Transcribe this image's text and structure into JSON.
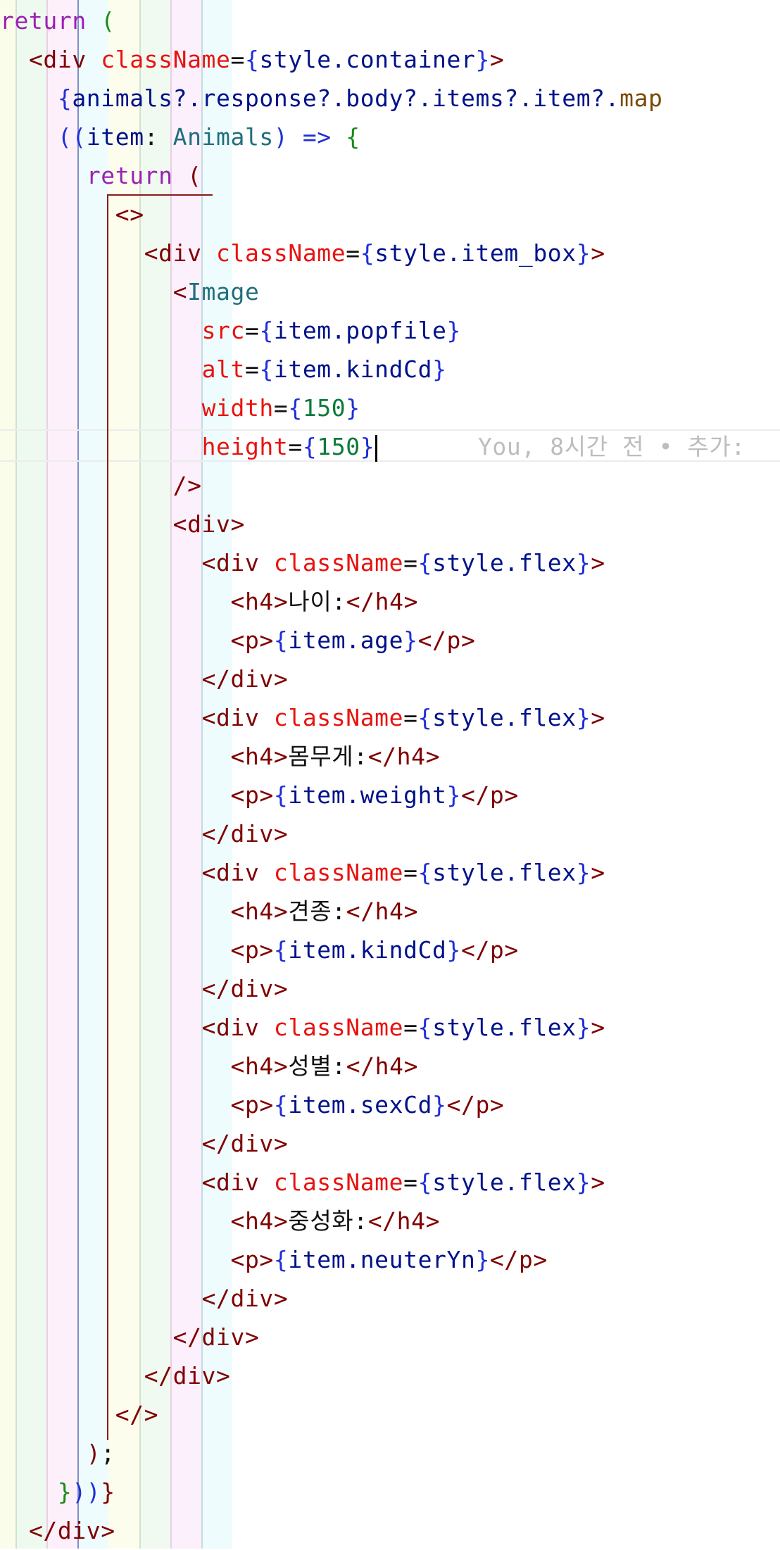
{
  "editor": {
    "colors": {
      "keyword": "#9b21b2",
      "paren": "#1a8a1a",
      "brace": "#1f2fd8",
      "tag": "#800000",
      "attribute": "#e8130f",
      "variable": "#00128a",
      "function": "#7b4a00",
      "type": "#1f6f7a",
      "number": "#0b7a3b",
      "text": "#111111",
      "blame": "#bdbdbd"
    },
    "lines": [
      [
        [
          "kw",
          "return"
        ],
        [
          "tx",
          " "
        ],
        [
          "pn",
          "("
        ]
      ],
      [
        [
          "tx",
          "  "
        ],
        [
          "tg",
          "<div"
        ],
        [
          "tx",
          " "
        ],
        [
          "at",
          "className"
        ],
        [
          "tx",
          "="
        ],
        [
          "pb",
          "{"
        ],
        [
          "vr",
          "style.container"
        ],
        [
          "pb",
          "}"
        ],
        [
          "tg",
          ">"
        ]
      ],
      [
        [
          "tx",
          "    "
        ],
        [
          "pb",
          "{"
        ],
        [
          "vr",
          "animals?.response?.body?.items?.item?."
        ],
        [
          "fn",
          "map"
        ]
      ],
      [
        [
          "tx",
          "    "
        ],
        [
          "pb",
          "(("
        ],
        [
          "vr",
          "item"
        ],
        [
          "tx",
          ": "
        ],
        [
          "ty",
          "Animals"
        ],
        [
          "pb",
          ")"
        ],
        [
          "tx",
          " "
        ],
        [
          "pb",
          "=>"
        ],
        [
          "tx",
          " "
        ],
        [
          "pn",
          "{"
        ]
      ],
      [
        [
          "tx",
          "      "
        ],
        [
          "kw",
          "return"
        ],
        [
          "tx",
          " "
        ],
        [
          "tg",
          "("
        ]
      ],
      [
        [
          "tx",
          "        "
        ],
        [
          "tg",
          "<>"
        ]
      ],
      [
        [
          "tx",
          "          "
        ],
        [
          "tg",
          "<div"
        ],
        [
          "tx",
          " "
        ],
        [
          "at",
          "className"
        ],
        [
          "tx",
          "="
        ],
        [
          "pb",
          "{"
        ],
        [
          "vr",
          "style.item_box"
        ],
        [
          "pb",
          "}"
        ],
        [
          "tg",
          ">"
        ]
      ],
      [
        [
          "tx",
          "            "
        ],
        [
          "tg",
          "<"
        ],
        [
          "ty",
          "Image"
        ]
      ],
      [
        [
          "tx",
          "              "
        ],
        [
          "at",
          "src"
        ],
        [
          "tx",
          "="
        ],
        [
          "pb",
          "{"
        ],
        [
          "vr",
          "item.popfile"
        ],
        [
          "pb",
          "}"
        ]
      ],
      [
        [
          "tx",
          "              "
        ],
        [
          "at",
          "alt"
        ],
        [
          "tx",
          "="
        ],
        [
          "pb",
          "{"
        ],
        [
          "vr",
          "item.kindCd"
        ],
        [
          "pb",
          "}"
        ]
      ],
      [
        [
          "tx",
          "              "
        ],
        [
          "at",
          "width"
        ],
        [
          "tx",
          "="
        ],
        [
          "pb",
          "{"
        ],
        [
          "nm",
          "150"
        ],
        [
          "pb",
          "}"
        ]
      ],
      [
        [
          "tx",
          "              "
        ],
        [
          "at",
          "height"
        ],
        [
          "tx",
          "="
        ],
        [
          "pb",
          "{"
        ],
        [
          "nm",
          "150"
        ],
        [
          "pb",
          "}"
        ],
        [
          "caret",
          ""
        ],
        [
          "tx",
          "       "
        ],
        [
          "bl",
          "You, 8시간 전 • 추가:"
        ]
      ],
      [
        [
          "tx",
          "            "
        ],
        [
          "tg",
          "/>"
        ]
      ],
      [
        [
          "tx",
          "            "
        ],
        [
          "tg",
          "<div>"
        ]
      ],
      [
        [
          "tx",
          "              "
        ],
        [
          "tg",
          "<div"
        ],
        [
          "tx",
          " "
        ],
        [
          "at",
          "className"
        ],
        [
          "tx",
          "="
        ],
        [
          "pb",
          "{"
        ],
        [
          "vr",
          "style.flex"
        ],
        [
          "pb",
          "}"
        ],
        [
          "tg",
          ">"
        ]
      ],
      [
        [
          "tx",
          "                "
        ],
        [
          "tg",
          "<h4>"
        ],
        [
          "tx",
          "나이:"
        ],
        [
          "tg",
          "</h4>"
        ]
      ],
      [
        [
          "tx",
          "                "
        ],
        [
          "tg",
          "<p>"
        ],
        [
          "pb",
          "{"
        ],
        [
          "vr",
          "item.age"
        ],
        [
          "pb",
          "}"
        ],
        [
          "tg",
          "</p>"
        ]
      ],
      [
        [
          "tx",
          "              "
        ],
        [
          "tg",
          "</div>"
        ]
      ],
      [
        [
          "tx",
          "              "
        ],
        [
          "tg",
          "<div"
        ],
        [
          "tx",
          " "
        ],
        [
          "at",
          "className"
        ],
        [
          "tx",
          "="
        ],
        [
          "pb",
          "{"
        ],
        [
          "vr",
          "style.flex"
        ],
        [
          "pb",
          "}"
        ],
        [
          "tg",
          ">"
        ]
      ],
      [
        [
          "tx",
          "                "
        ],
        [
          "tg",
          "<h4>"
        ],
        [
          "tx",
          "몸무게:"
        ],
        [
          "tg",
          "</h4>"
        ]
      ],
      [
        [
          "tx",
          "                "
        ],
        [
          "tg",
          "<p>"
        ],
        [
          "pb",
          "{"
        ],
        [
          "vr",
          "item.weight"
        ],
        [
          "pb",
          "}"
        ],
        [
          "tg",
          "</p>"
        ]
      ],
      [
        [
          "tx",
          "              "
        ],
        [
          "tg",
          "</div>"
        ]
      ],
      [
        [
          "tx",
          "              "
        ],
        [
          "tg",
          "<div"
        ],
        [
          "tx",
          " "
        ],
        [
          "at",
          "className"
        ],
        [
          "tx",
          "="
        ],
        [
          "pb",
          "{"
        ],
        [
          "vr",
          "style.flex"
        ],
        [
          "pb",
          "}"
        ],
        [
          "tg",
          ">"
        ]
      ],
      [
        [
          "tx",
          "                "
        ],
        [
          "tg",
          "<h4>"
        ],
        [
          "tx",
          "견종:"
        ],
        [
          "tg",
          "</h4>"
        ]
      ],
      [
        [
          "tx",
          "                "
        ],
        [
          "tg",
          "<p>"
        ],
        [
          "pb",
          "{"
        ],
        [
          "vr",
          "item.kindCd"
        ],
        [
          "pb",
          "}"
        ],
        [
          "tg",
          "</p>"
        ]
      ],
      [
        [
          "tx",
          "              "
        ],
        [
          "tg",
          "</div>"
        ]
      ],
      [
        [
          "tx",
          "              "
        ],
        [
          "tg",
          "<div"
        ],
        [
          "tx",
          " "
        ],
        [
          "at",
          "className"
        ],
        [
          "tx",
          "="
        ],
        [
          "pb",
          "{"
        ],
        [
          "vr",
          "style.flex"
        ],
        [
          "pb",
          "}"
        ],
        [
          "tg",
          ">"
        ]
      ],
      [
        [
          "tx",
          "                "
        ],
        [
          "tg",
          "<h4>"
        ],
        [
          "tx",
          "성별:"
        ],
        [
          "tg",
          "</h4>"
        ]
      ],
      [
        [
          "tx",
          "                "
        ],
        [
          "tg",
          "<p>"
        ],
        [
          "pb",
          "{"
        ],
        [
          "vr",
          "item.sexCd"
        ],
        [
          "pb",
          "}"
        ],
        [
          "tg",
          "</p>"
        ]
      ],
      [
        [
          "tx",
          "              "
        ],
        [
          "tg",
          "</div>"
        ]
      ],
      [
        [
          "tx",
          "              "
        ],
        [
          "tg",
          "<div"
        ],
        [
          "tx",
          " "
        ],
        [
          "at",
          "className"
        ],
        [
          "tx",
          "="
        ],
        [
          "pb",
          "{"
        ],
        [
          "vr",
          "style.flex"
        ],
        [
          "pb",
          "}"
        ],
        [
          "tg",
          ">"
        ]
      ],
      [
        [
          "tx",
          "                "
        ],
        [
          "tg",
          "<h4>"
        ],
        [
          "tx",
          "중성화:"
        ],
        [
          "tg",
          "</h4>"
        ]
      ],
      [
        [
          "tx",
          "                "
        ],
        [
          "tg",
          "<p>"
        ],
        [
          "pb",
          "{"
        ],
        [
          "vr",
          "item.neuterYn"
        ],
        [
          "pb",
          "}"
        ],
        [
          "tg",
          "</p>"
        ]
      ],
      [
        [
          "tx",
          "              "
        ],
        [
          "tg",
          "</div>"
        ]
      ],
      [
        [
          "tx",
          "            "
        ],
        [
          "tg",
          "</div>"
        ]
      ],
      [
        [
          "tx",
          "          "
        ],
        [
          "tg",
          "</div>"
        ]
      ],
      [
        [
          "tx",
          "        "
        ],
        [
          "tg",
          "</>"
        ]
      ],
      [
        [
          "tx",
          "      "
        ],
        [
          "tg",
          ")"
        ],
        [
          "tx",
          ";"
        ]
      ],
      [
        [
          "tx",
          "    "
        ],
        [
          "pn",
          "}"
        ],
        [
          "pb",
          "))"
        ],
        [
          "tg",
          "}"
        ]
      ],
      [
        [
          "tx",
          "  "
        ],
        [
          "tg",
          "</div>"
        ]
      ]
    ]
  }
}
